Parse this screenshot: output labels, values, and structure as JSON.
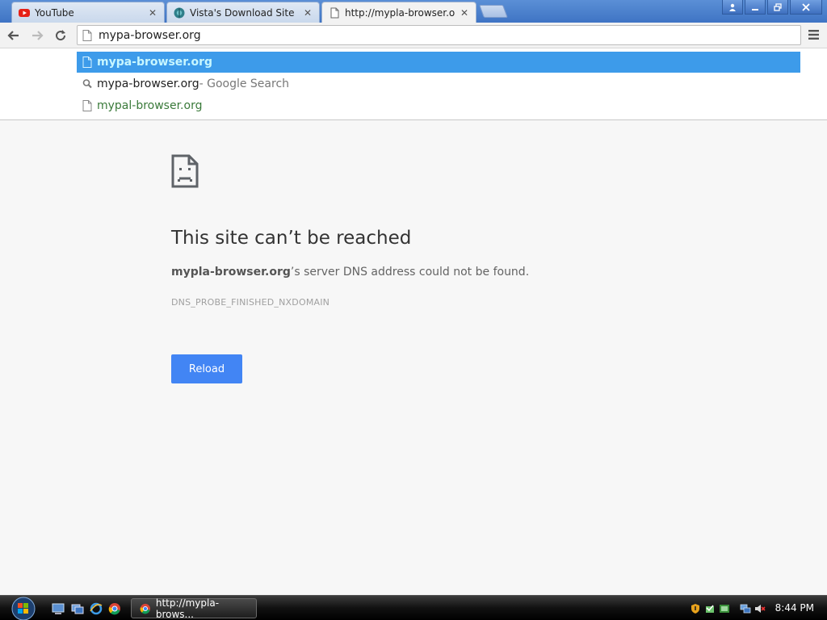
{
  "tabs": [
    {
      "title": "YouTube",
      "icon": "youtube-icon",
      "active": false
    },
    {
      "title": "Vista's Download Site",
      "icon": "site-globe-icon",
      "active": false
    },
    {
      "title": "http://mypla-browser.org",
      "icon": "page-icon",
      "active": true
    }
  ],
  "omnibox": {
    "value": "mypa-browser.org"
  },
  "suggestions": [
    {
      "main": "mypa-browser.org",
      "desc": "",
      "icon": "page-icon",
      "selected": true
    },
    {
      "main": "mypa-browser.org",
      "desc": " - Google Search",
      "icon": "search-icon",
      "selected": false
    },
    {
      "main": "mypal-browser.org",
      "desc": "",
      "icon": "page-icon",
      "selected": false
    }
  ],
  "error": {
    "heading": "This site can’t be reached",
    "host": "mypla-browser.org",
    "message_rest": "’s server DNS address could not be found.",
    "code": "DNS_PROBE_FINISHED_NXDOMAIN",
    "reload_label": "Reload"
  },
  "taskbar": {
    "active_window": "http://mypla-brows...",
    "clock": "8:44 PM"
  },
  "colors": {
    "accent_blue": "#4285f4",
    "selection": "#3d9bea",
    "youtube_red": "#e62117"
  }
}
